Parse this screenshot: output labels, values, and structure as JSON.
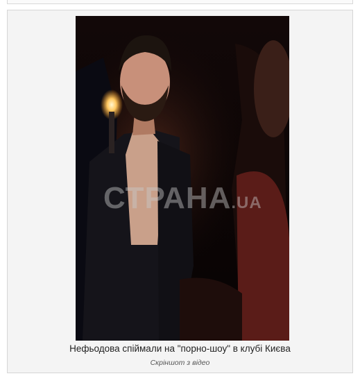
{
  "article": {
    "figure": {
      "image_description_icon": "photo",
      "watermark_main": "СТРАНА",
      "watermark_tld": ".UA",
      "caption": "Нефьодова спіймали на \"порно-шоу\" в клубі Києва",
      "credit": "Скріншот з відео"
    }
  },
  "colors": {
    "background": "#f4f4f4",
    "border": "#d6d6d6",
    "photo_dark": "#0b0606",
    "caption_text": "#222222",
    "credit_text": "#555555"
  }
}
